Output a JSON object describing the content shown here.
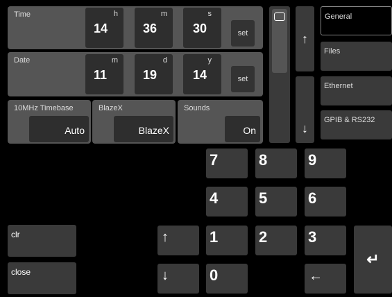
{
  "time": {
    "label": "Time",
    "h_label": "h",
    "m_label": "m",
    "s_label": "s",
    "h": "14",
    "m": "36",
    "s": "30",
    "set_label": "set"
  },
  "date": {
    "label": "Date",
    "m_label": "m",
    "d_label": "d",
    "y_label": "y",
    "m": "11",
    "d": "19",
    "y": "14",
    "set_label": "set"
  },
  "timebase": {
    "label": "10MHz Timebase",
    "value": "Auto"
  },
  "blazex": {
    "label": "BlazeX",
    "value": "BlazeX"
  },
  "sounds": {
    "label": "Sounds",
    "value": "On"
  },
  "nav": {
    "items": [
      {
        "label": "General"
      },
      {
        "label": "Files"
      },
      {
        "label": "Ethernet"
      },
      {
        "label": "GPIB & RS232"
      }
    ],
    "selected": "General"
  },
  "keypad": {
    "k7": "7",
    "k8": "8",
    "k9": "9",
    "k4": "4",
    "k5": "5",
    "k6": "6",
    "k1": "1",
    "k2": "2",
    "k3": "3",
    "k0": "0"
  },
  "buttons": {
    "clr": "clr",
    "close": "close"
  },
  "icons": {
    "up": "arrow-up-icon",
    "down": "arrow-down-icon",
    "enter": "enter-icon",
    "backspace": "backspace-arrow-icon",
    "scroll_thumb": "scroll-thumb"
  }
}
